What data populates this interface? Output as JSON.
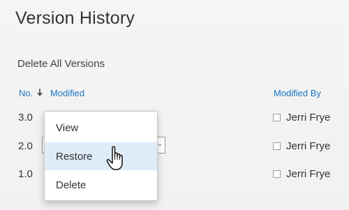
{
  "panel": {
    "title": "Version History",
    "delete_all_label": "Delete All Versions"
  },
  "columns": {
    "number": "No.",
    "modified": "Modified",
    "modified_by": "Modified By"
  },
  "sort": {
    "direction": "descending",
    "icon": "arrow-down-icon"
  },
  "versions": [
    {
      "number": "3.0",
      "modified_by": "Jerri Frye"
    },
    {
      "number": "2.0",
      "modified_by": "Jerri Frye"
    },
    {
      "number": "1.0",
      "modified_by": "Jerri Frye"
    }
  ],
  "context_menu": {
    "items": [
      {
        "label": "View"
      },
      {
        "label": "Restore",
        "highlighted": true
      },
      {
        "label": "Delete"
      }
    ]
  },
  "colors": {
    "accent": "#1a73c5",
    "menu_highlight": "#deecf9"
  }
}
